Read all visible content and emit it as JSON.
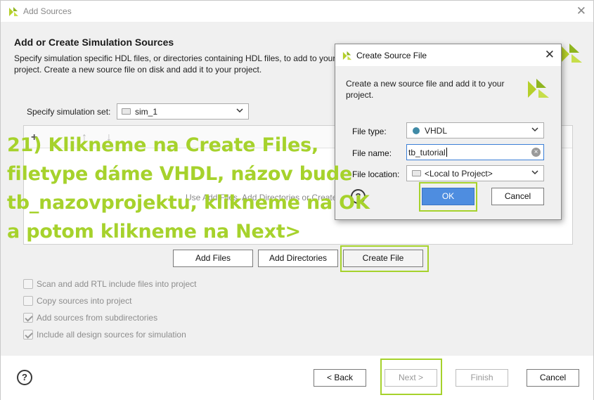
{
  "window": {
    "title": "Add Sources",
    "close_glyph": "✕"
  },
  "page": {
    "heading": "Add or Create Simulation Sources",
    "description": "Specify simulation specific HDL files, or directories containing HDL files, to add to your project. Create a new source file on disk and add it to your project."
  },
  "sim_set": {
    "label": "Specify simulation set:",
    "value": "sim_1"
  },
  "list": {
    "toolbar": {
      "add": "+",
      "up": "↑",
      "down": "↓"
    },
    "hint": "Use Add Files, Add Directories or Create File buttons below"
  },
  "buttons": {
    "add_files": "Add Files",
    "add_directories": "Add Directories",
    "create_file": "Create File",
    "back": "< Back",
    "next": "Next >",
    "finish": "Finish",
    "cancel": "Cancel"
  },
  "options": [
    {
      "label": "Scan and add RTL include files into project",
      "checked": false
    },
    {
      "label": "Copy sources into project",
      "checked": false
    },
    {
      "label": "Add sources from subdirectories",
      "checked": true
    },
    {
      "label": "Include all design sources for simulation",
      "checked": true
    }
  ],
  "dialog": {
    "title": "Create Source File",
    "close_glyph": "✕",
    "description": "Create a new source file and add it to your project.",
    "file_type_label": "File type:",
    "file_type_value": "VHDL",
    "file_name_label": "File name:",
    "file_name_value": "tb_tutorial",
    "file_location_label": "File location:",
    "file_location_value": "<Local to Project>",
    "ok": "OK",
    "cancel": "Cancel",
    "help": "?"
  },
  "help_glyph": "?",
  "annotation": {
    "lines": [
      "21) Klikneme na Create Files,",
      "filetype dáme VHDL, názov bude",
      "tb_nazovprojektu, klikneme na OK",
      "a potom klikneme na Next>"
    ]
  },
  "colors": {
    "highlight": "#a6d22c",
    "primary_button": "#4e8de0",
    "vhdl_dot": "#3f8aa6"
  }
}
